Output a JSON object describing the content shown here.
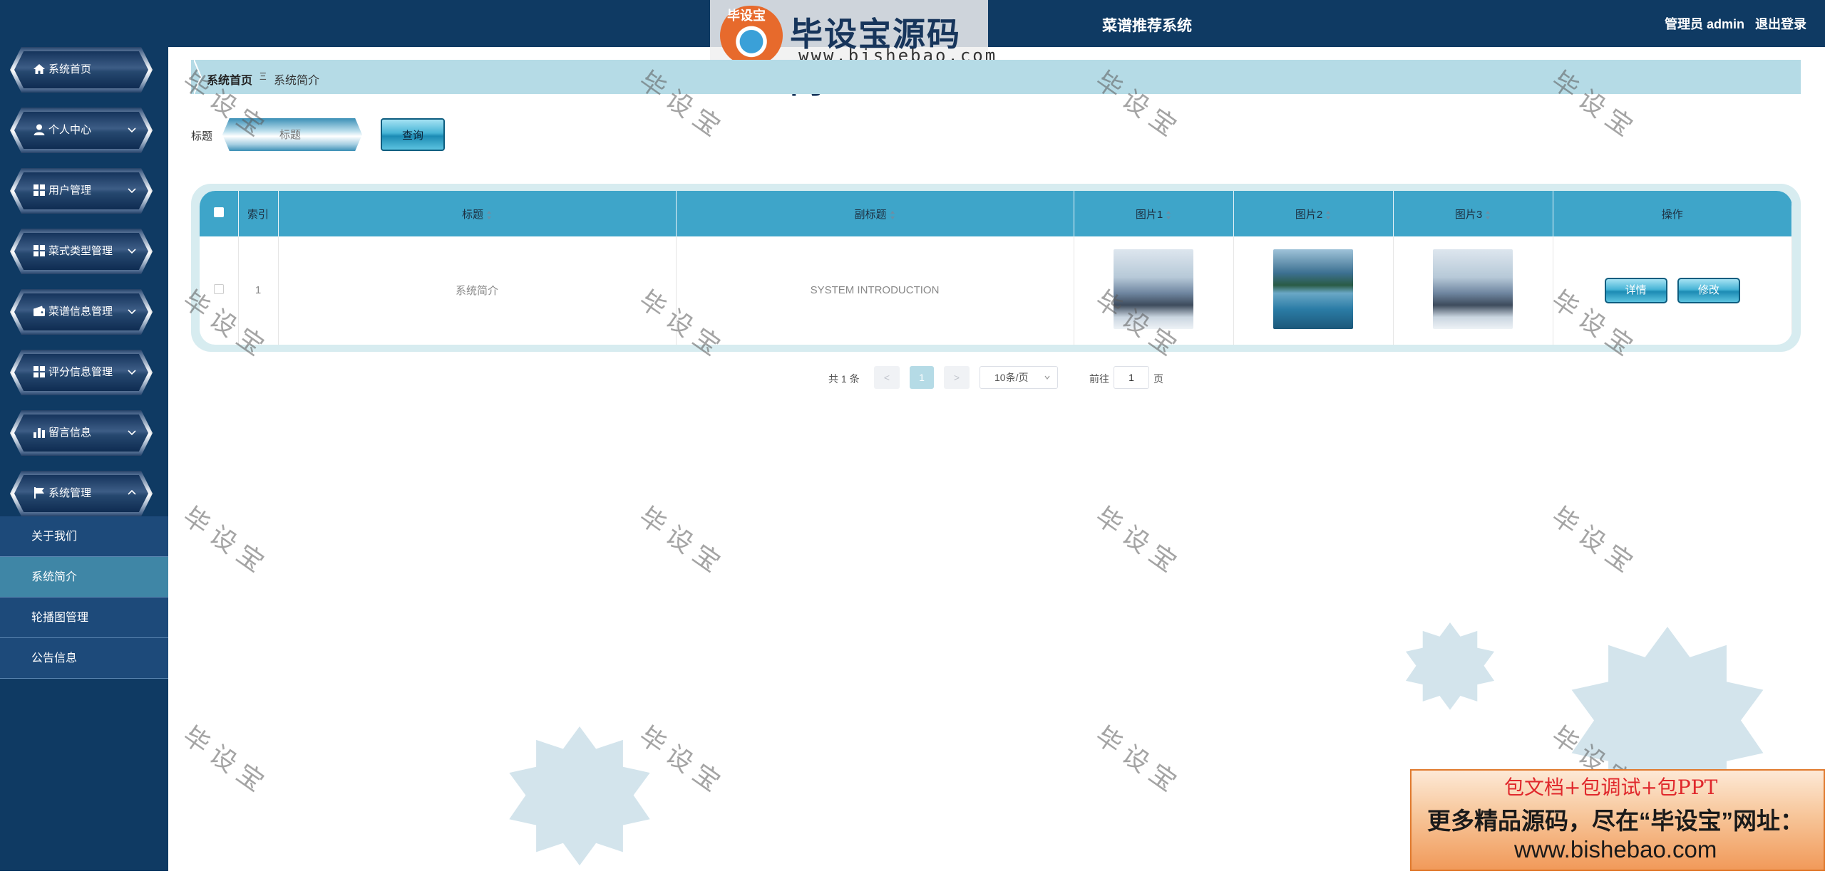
{
  "app": {
    "title": "菜谱推荐系统"
  },
  "user": {
    "role_label": "管理员 admin",
    "logout_label": "退出登录"
  },
  "watermark": {
    "logo_badge": "毕设宝",
    "logo_text": "毕设宝源码网",
    "logo_url": "www.bishebao.com",
    "text": "毕设宝"
  },
  "sidebar": {
    "items": [
      {
        "label": "系统首页",
        "icon": "home-icon",
        "expandable": false
      },
      {
        "label": "个人中心",
        "icon": "user-icon",
        "expandable": true
      },
      {
        "label": "用户管理",
        "icon": "grid-icon",
        "expandable": true
      },
      {
        "label": "菜式类型管理",
        "icon": "grid-icon",
        "expandable": true
      },
      {
        "label": "菜谱信息管理",
        "icon": "wallet-icon",
        "expandable": true
      },
      {
        "label": "评分信息管理",
        "icon": "grid-icon",
        "expandable": true
      },
      {
        "label": "留言信息",
        "icon": "bar-chart-icon",
        "expandable": true
      },
      {
        "label": "系统管理",
        "icon": "flag-icon",
        "expandable": true,
        "expanded": true
      }
    ],
    "submenu": [
      {
        "label": "关于我们",
        "active": false
      },
      {
        "label": "系统简介",
        "active": true
      },
      {
        "label": "轮播图管理",
        "active": false
      },
      {
        "label": "公告信息",
        "active": false
      }
    ]
  },
  "breadcrumb": {
    "home": "系统首页",
    "separator": "Ξ",
    "current": "系统简介"
  },
  "search": {
    "label": "标题",
    "placeholder": "标题",
    "button": "查询"
  },
  "table": {
    "columns": [
      "索引",
      "标题",
      "副标题",
      "图片1",
      "图片2",
      "图片3",
      "操作"
    ],
    "rows": [
      {
        "index": "1",
        "title": "系统简介",
        "subtitle": "SYSTEM INTRODUCTION",
        "images": [
          "castle",
          "lake",
          "castle"
        ]
      }
    ],
    "detail_button": "详情",
    "edit_button": "修改"
  },
  "pagination": {
    "total": "共 1 条",
    "prev": "<",
    "current_page": "1",
    "next": ">",
    "page_size": "10条/页",
    "goto_label": "前往",
    "goto_value": "1",
    "page_suffix": "页"
  },
  "ad": {
    "line1": "包文档+包调试+包PPT",
    "line2": "更多精品源码，尽在“毕设宝”网址：",
    "line3": "www.bishebao.com"
  },
  "colors": {
    "sidebar": "#0f3a63",
    "accent": "#3ea5c9",
    "breadcrumb": "#b5dbe6",
    "active_sub": "#3f86a6"
  }
}
